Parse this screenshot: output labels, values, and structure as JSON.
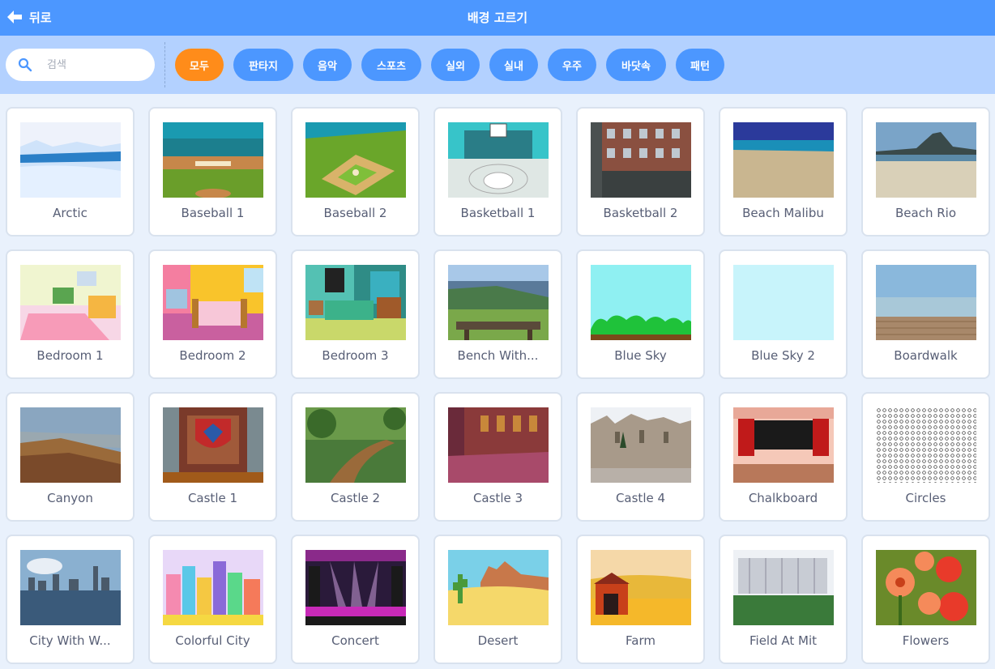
{
  "header": {
    "back_label": "뒤로",
    "title": "배경 고르기"
  },
  "search": {
    "placeholder": "검색"
  },
  "tags": [
    "모두",
    "판타지",
    "음악",
    "스포츠",
    "실외",
    "실내",
    "우주",
    "바닷속",
    "패턴"
  ],
  "active_tag": "모두",
  "colors": {
    "header": "#4c97ff",
    "filter_bar": "#b3d1ff",
    "active_tag": "#ff8c1a",
    "tag": "#4c97ff",
    "page_bg": "#e9f1fc",
    "text": "#575e75"
  },
  "backdrops": [
    {
      "name": "Arctic",
      "icon": "arctic-thumbnail"
    },
    {
      "name": "Baseball 1",
      "icon": "baseball-1-thumbnail"
    },
    {
      "name": "Baseball 2",
      "icon": "baseball-2-thumbnail"
    },
    {
      "name": "Basketball 1",
      "icon": "basketball-1-thumbnail"
    },
    {
      "name": "Basketball 2",
      "icon": "basketball-2-thumbnail"
    },
    {
      "name": "Beach Malibu",
      "icon": "beach-malibu-thumbnail"
    },
    {
      "name": "Beach Rio",
      "icon": "beach-rio-thumbnail"
    },
    {
      "name": "Bedroom 1",
      "icon": "bedroom-1-thumbnail"
    },
    {
      "name": "Bedroom 2",
      "icon": "bedroom-2-thumbnail"
    },
    {
      "name": "Bedroom 3",
      "icon": "bedroom-3-thumbnail"
    },
    {
      "name": "Bench With...",
      "icon": "bench-with-view-thumbnail"
    },
    {
      "name": "Blue Sky",
      "icon": "blue-sky-thumbnail"
    },
    {
      "name": "Blue Sky 2",
      "icon": "blue-sky-2-thumbnail"
    },
    {
      "name": "Boardwalk",
      "icon": "boardwalk-thumbnail"
    },
    {
      "name": "Canyon",
      "icon": "canyon-thumbnail"
    },
    {
      "name": "Castle 1",
      "icon": "castle-1-thumbnail"
    },
    {
      "name": "Castle 2",
      "icon": "castle-2-thumbnail"
    },
    {
      "name": "Castle 3",
      "icon": "castle-3-thumbnail"
    },
    {
      "name": "Castle 4",
      "icon": "castle-4-thumbnail"
    },
    {
      "name": "Chalkboard",
      "icon": "chalkboard-thumbnail"
    },
    {
      "name": "Circles",
      "icon": "circles-thumbnail"
    },
    {
      "name": "City With W...",
      "icon": "city-with-water-thumbnail"
    },
    {
      "name": "Colorful City",
      "icon": "colorful-city-thumbnail"
    },
    {
      "name": "Concert",
      "icon": "concert-thumbnail"
    },
    {
      "name": "Desert",
      "icon": "desert-thumbnail"
    },
    {
      "name": "Farm",
      "icon": "farm-thumbnail"
    },
    {
      "name": "Field At Mit",
      "icon": "field-at-mit-thumbnail"
    },
    {
      "name": "Flowers",
      "icon": "flowers-thumbnail"
    }
  ]
}
